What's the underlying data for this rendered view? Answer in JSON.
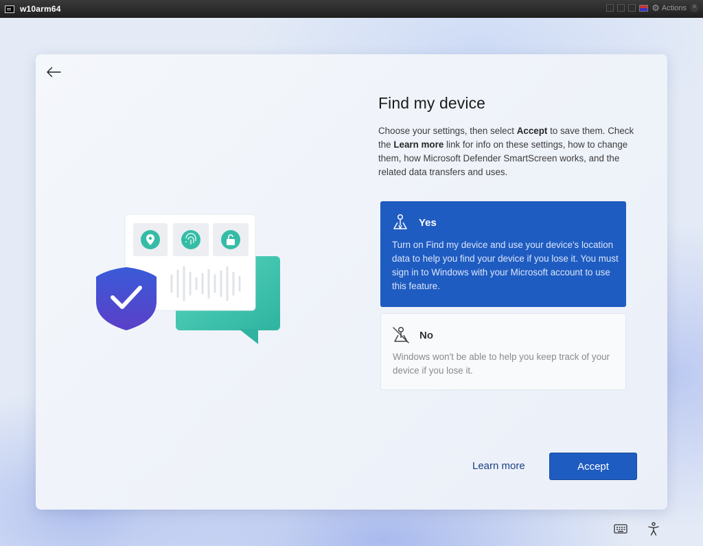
{
  "vm_window": {
    "title": "w10arm64",
    "actions_label": "Actions"
  },
  "oobe": {
    "title": "Find my device",
    "description": {
      "part1": "Choose your settings, then select ",
      "accept_word": "Accept",
      "part2": " to save them. Check the ",
      "learn_more_word": "Learn more",
      "part3": " link for info on these settings, how to change them, how Microsoft Defender SmartScreen works, and the related data transfers and uses."
    },
    "options": [
      {
        "label": "Yes",
        "text": "Turn on Find my device and use your device's location data to help you find your device if you lose it. You must sign in to Windows with your Microsoft account to use this feature.",
        "selected": true,
        "icon": "location-person-icon"
      },
      {
        "label": "No",
        "text": "Windows won't be able to help you keep track of your device if you lose it.",
        "selected": false,
        "icon": "location-person-off-icon"
      }
    ],
    "learn_more_label": "Learn more",
    "accept_label": "Accept"
  },
  "tray": {
    "keyboard_icon": "keyboard-icon",
    "accessibility_icon": "accessibility-icon"
  },
  "colors": {
    "accent": "#1f5cc1",
    "link": "#1a3f85",
    "teal": "#3fc4ad",
    "shield": "#3f4fd0"
  }
}
